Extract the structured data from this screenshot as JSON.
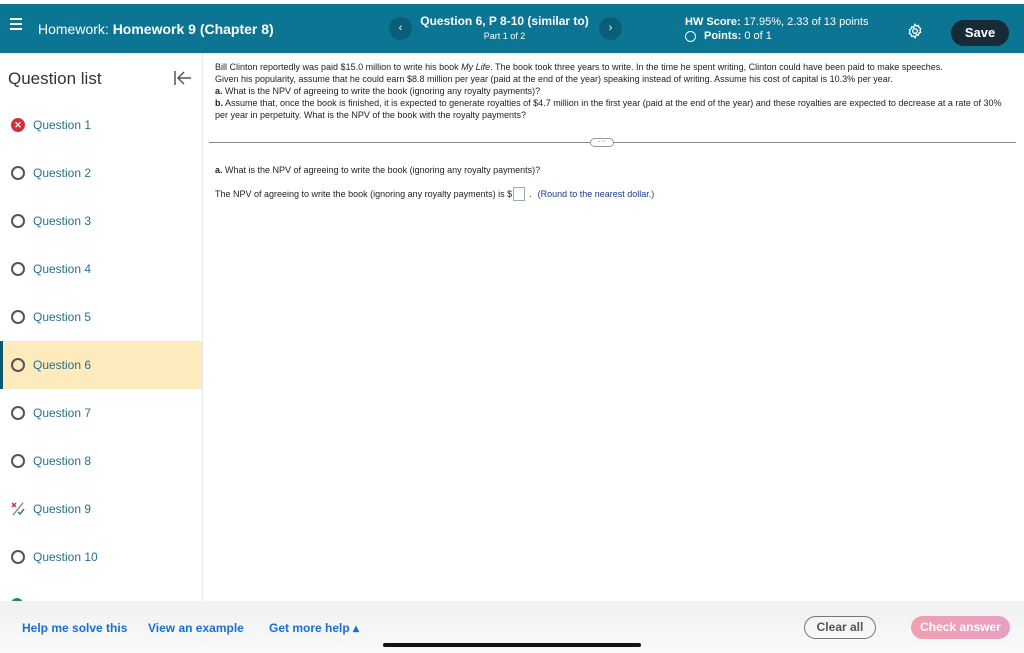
{
  "header": {
    "menu_icon": "hamburger-icon",
    "hw_prefix": "Homework:",
    "hw_name": "Homework 9 (Chapter 8)",
    "prev_label": "‹",
    "next_label": "›",
    "question_title": "Question 6, P 8-10 (similar to)",
    "question_part": "Part 1 of 2",
    "score_label": "HW Score:",
    "score_value": "17.95%, 2.33 of 13 points",
    "points_label": "Points:",
    "points_value": "0 of 1",
    "save_label": "Save"
  },
  "sidebar": {
    "title": "Question list",
    "items": [
      {
        "label": "Question 1",
        "status": "incorrect"
      },
      {
        "label": "Question 2",
        "status": "unanswered"
      },
      {
        "label": "Question 3",
        "status": "unanswered"
      },
      {
        "label": "Question 4",
        "status": "unanswered"
      },
      {
        "label": "Question 5",
        "status": "unanswered"
      },
      {
        "label": "Question 6",
        "status": "unanswered",
        "active": true
      },
      {
        "label": "Question 7",
        "status": "unanswered"
      },
      {
        "label": "Question 8",
        "status": "unanswered"
      },
      {
        "label": "Question 9",
        "status": "partial"
      },
      {
        "label": "Question 10",
        "status": "unanswered"
      }
    ]
  },
  "problem": {
    "line1_pre": "Bill Clinton reportedly was paid $15.0 million to write his book ",
    "book_title": "My Life",
    "line1_post": ". The book took three years to write. In the time he spent writing, Clinton could have been paid to make speeches.",
    "line2": "Given his popularity, assume that he could earn $8.8 million  per year (paid at the end of the year) speaking instead of writing. Assume his cost of capital is 10.3% per year.",
    "part_a_label": "a.",
    "part_a": " What is the NPV of agreeing to write the book (ignoring any royalty payments)?",
    "part_b_label": "b.",
    "part_b": " Assume that, once the book is finished, it is expected to generate royalties of $4.7 million in the first year (paid at the end of the year) and these royalties are expected to decrease at a rate of 30% per year in perpetuity. What is the NPV of the book with the royalty payments?"
  },
  "work": {
    "expand_label": "···",
    "question_label": "a.",
    "question": " What is the NPV of agreeing to write the book (ignoring any royalty payments)?",
    "answer_prefix": "The NPV of agreeing to write the book (ignoring any royalty payments) is $",
    "answer_value": "",
    "answer_suffix": ".",
    "hint": "(Round to the nearest dollar.)"
  },
  "footer": {
    "help_label": "Help me solve this",
    "example_label": "View an example",
    "more_help_label": "Get more help ▴",
    "clear_label": "Clear all",
    "check_label": "Check answer"
  }
}
